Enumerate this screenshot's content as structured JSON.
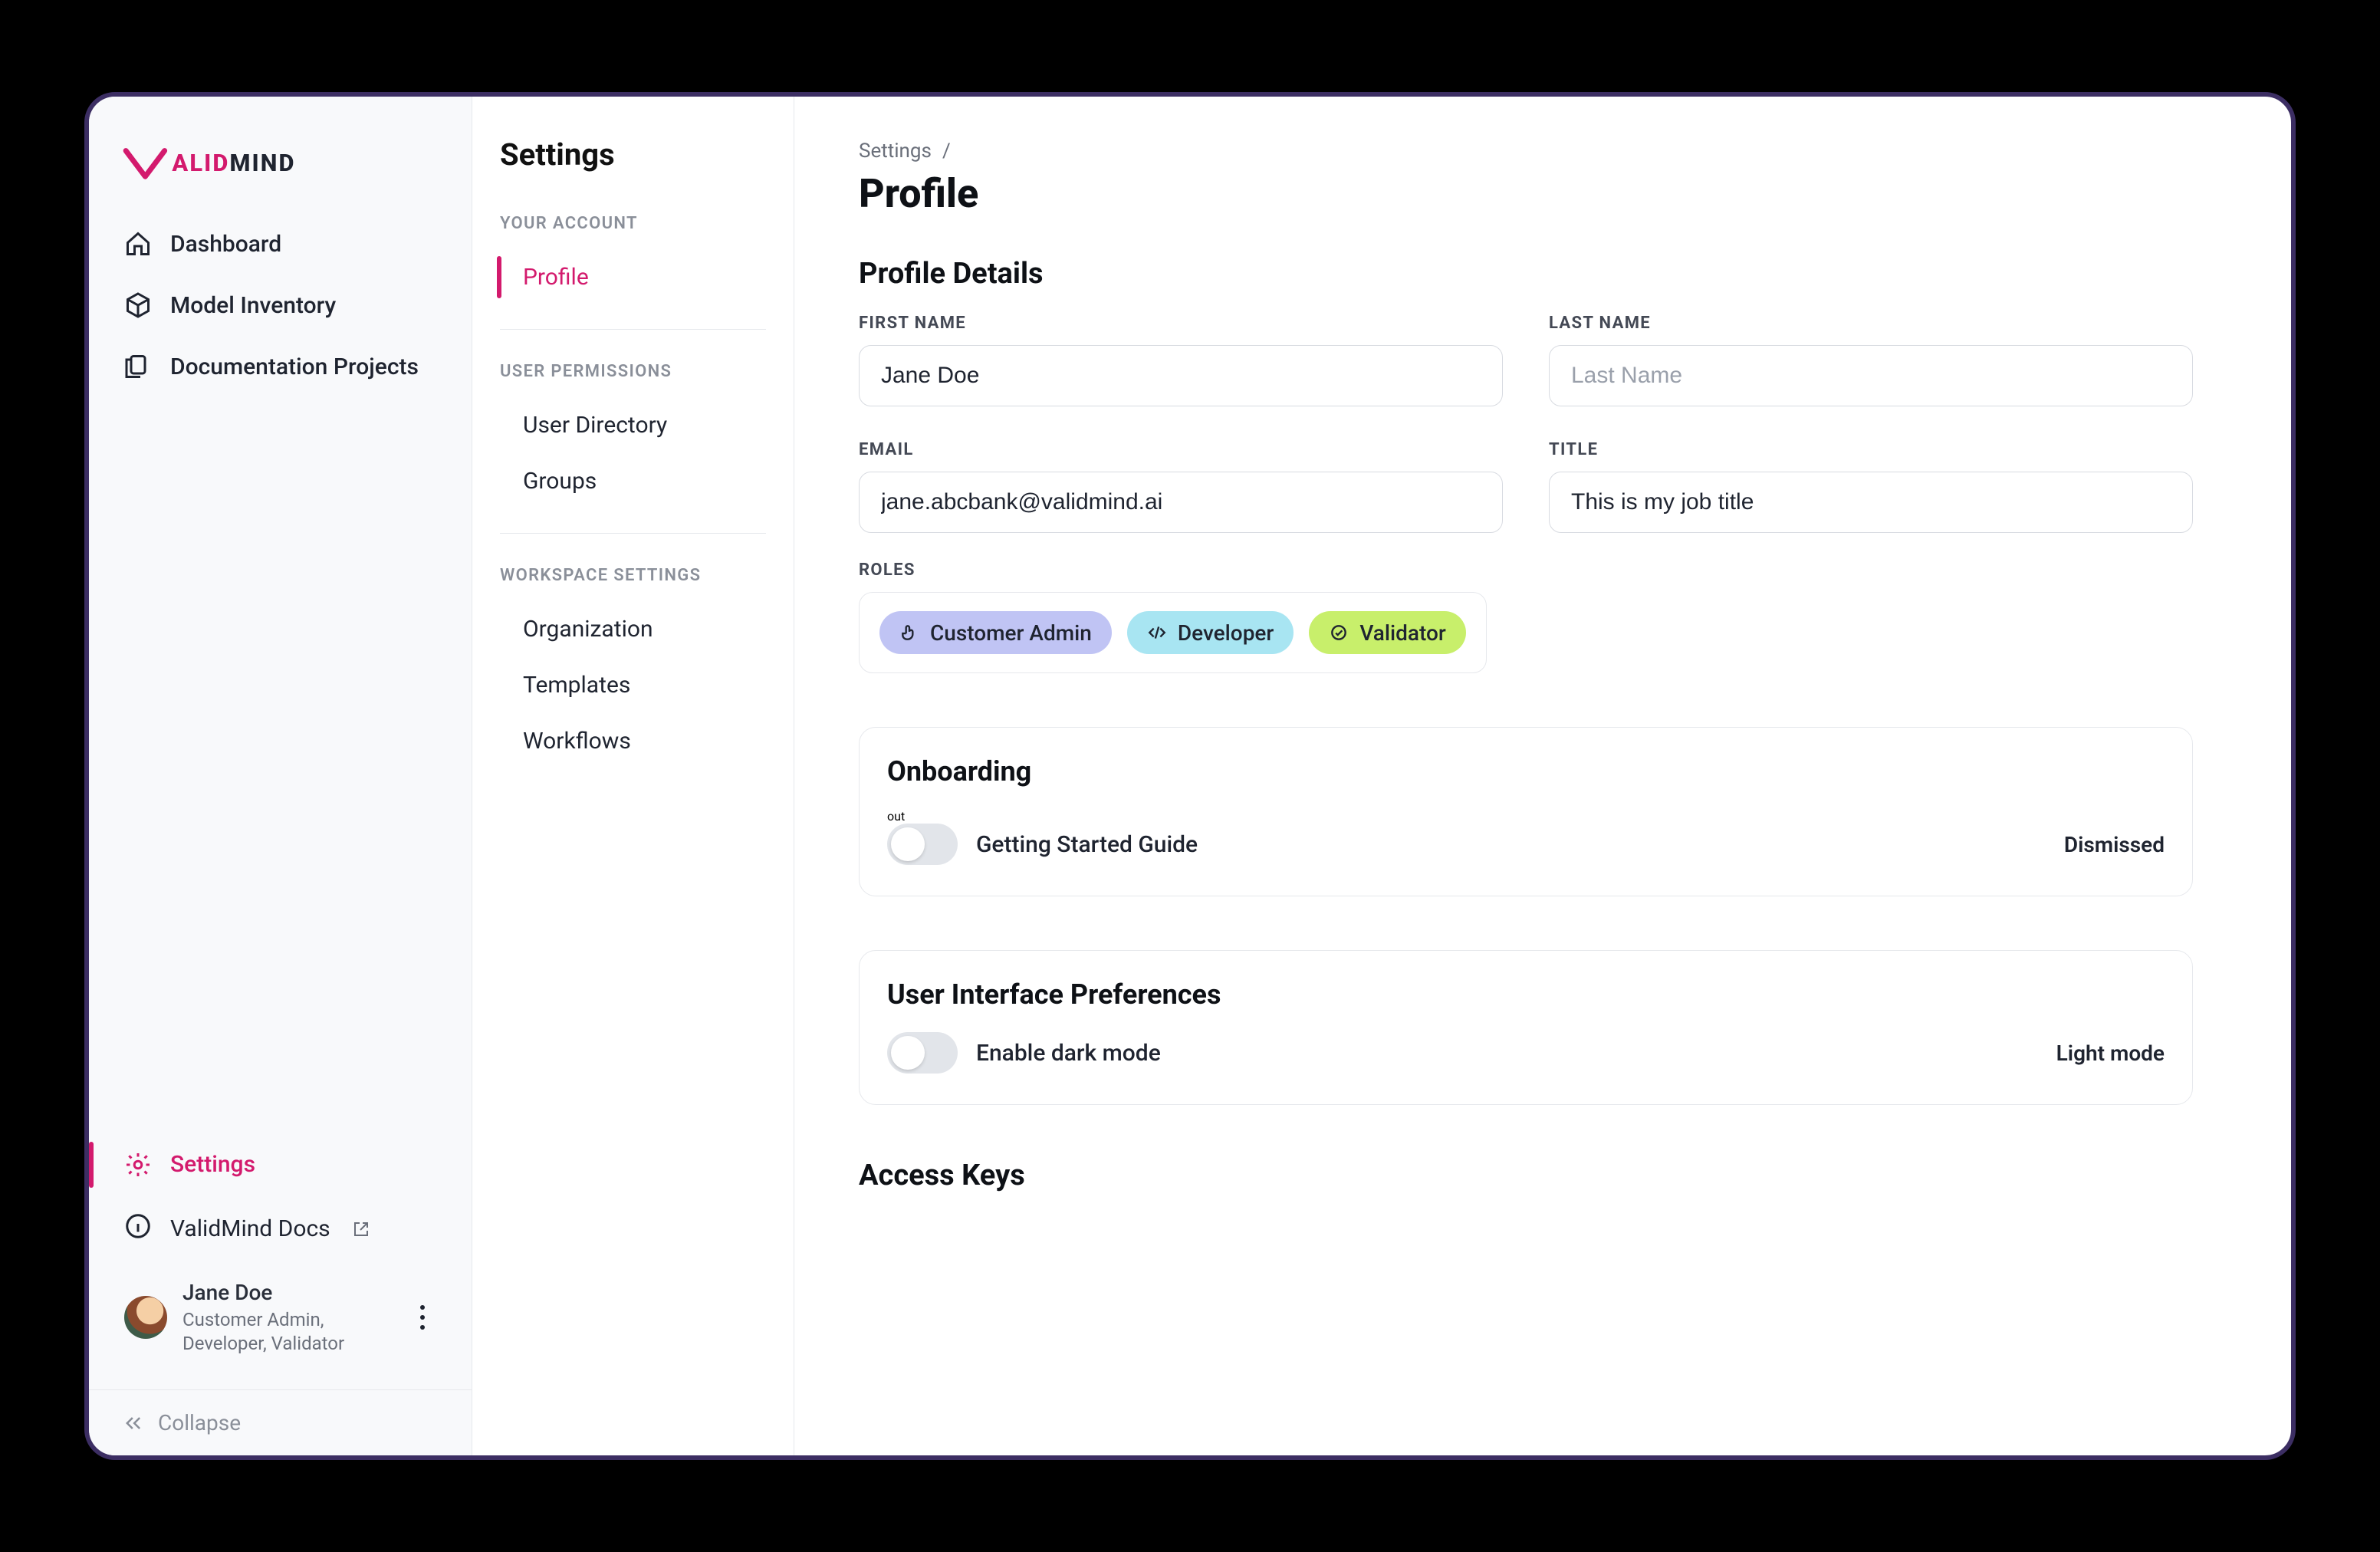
{
  "brand": {
    "name": "VALIDMIND",
    "accent": "#d31a6d"
  },
  "sidebar": {
    "items": [
      {
        "id": "dashboard",
        "label": "Dashboard",
        "icon": "home-icon"
      },
      {
        "id": "inventory",
        "label": "Model Inventory",
        "icon": "cube-icon"
      },
      {
        "id": "docs",
        "label": "Documentation Projects",
        "icon": "files-icon"
      }
    ],
    "settings_label": "Settings",
    "docs_link_label": "ValidMind Docs",
    "user": {
      "name": "Jane Doe",
      "roles_text": "Customer Admin, Developer, Validator"
    },
    "collapse_label": "Collapse"
  },
  "subnav": {
    "title": "Settings",
    "sections": [
      {
        "label": "YOUR ACCOUNT",
        "items": [
          {
            "id": "profile",
            "label": "Profile",
            "active": true
          }
        ]
      },
      {
        "label": "USER PERMISSIONS",
        "items": [
          {
            "id": "userdir",
            "label": "User Directory"
          },
          {
            "id": "groups",
            "label": "Groups"
          }
        ]
      },
      {
        "label": "WORKSPACE SETTINGS",
        "items": [
          {
            "id": "org",
            "label": "Organization"
          },
          {
            "id": "templates",
            "label": "Templates"
          },
          {
            "id": "workflows",
            "label": "Workflows"
          }
        ]
      }
    ]
  },
  "breadcrumb": {
    "root": "Settings",
    "sep": "/"
  },
  "page_title": "Profile",
  "profile_details": {
    "section_title": "Profile Details",
    "first_name": {
      "label": "FIRST NAME",
      "value": "Jane Doe"
    },
    "last_name": {
      "label": "LAST NAME",
      "value": "",
      "placeholder": "Last Name"
    },
    "email": {
      "label": "EMAIL",
      "value": "jane.abcbank@validmind.ai"
    },
    "title": {
      "label": "TITLE",
      "value": "This is my job title"
    },
    "roles_label": "ROLES",
    "roles": [
      {
        "name": "Customer Admin",
        "kind": "admin",
        "icon": "hand-icon"
      },
      {
        "name": "Developer",
        "kind": "dev",
        "icon": "code-icon"
      },
      {
        "name": "Validator",
        "kind": "val",
        "icon": "badge-icon"
      }
    ]
  },
  "onboarding": {
    "title": "Onboarding",
    "item_label": "Getting Started Guide",
    "status": "Dismissed"
  },
  "ui_prefs": {
    "title": "User Interface Preferences",
    "item_label": "Enable dark mode",
    "status": "Light mode"
  },
  "access_keys": {
    "title": "Access Keys"
  }
}
